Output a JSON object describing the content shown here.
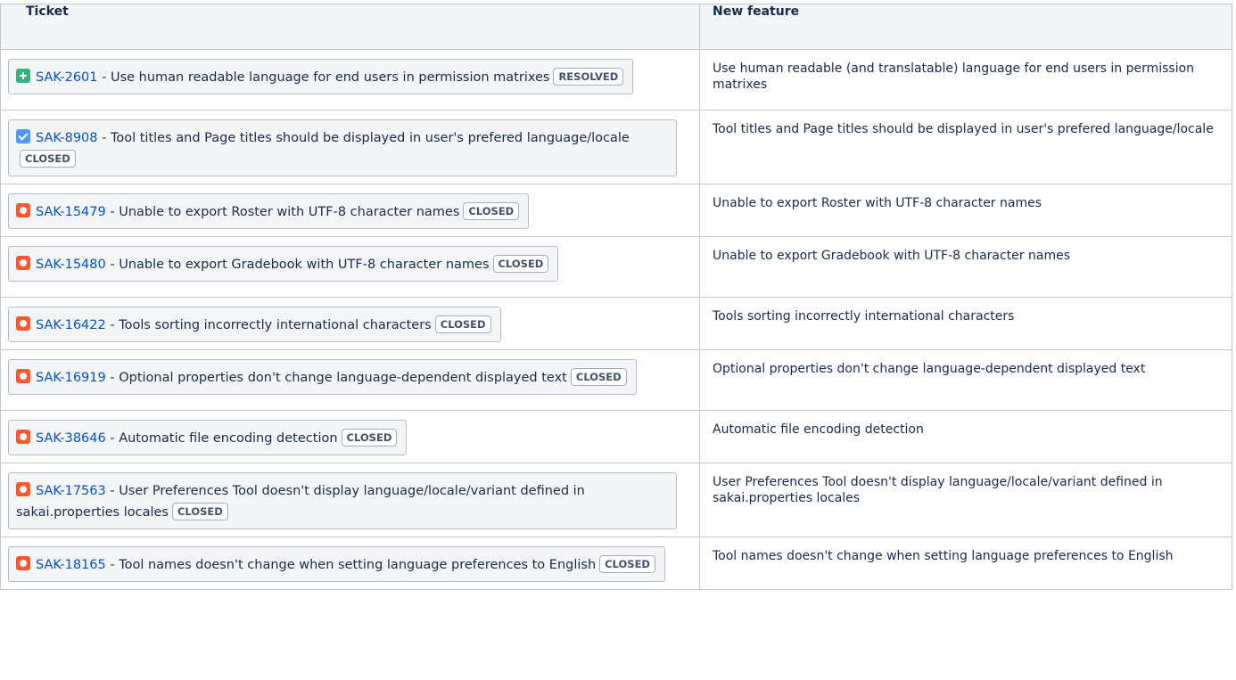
{
  "headers": {
    "ticket": "Ticket",
    "feature": "New feature"
  },
  "colors": {
    "link": "#0052cc",
    "new_feature_icon": "#36b37e",
    "task_icon": "#4c9aff",
    "bug_icon": "#ff5630"
  },
  "rows": [
    {
      "icon": "plus-icon",
      "key": "SAK-2601",
      "summary": "Use human readable language for end users in permission matrixes",
      "status": "RESOLVED",
      "feature": "Use human readable (and translatable) language for end users in permission matrixes"
    },
    {
      "icon": "check-icon",
      "key": "SAK-8908",
      "summary": "Tool titles and Page titles should be displayed in user's prefered language/locale",
      "status": "CLOSED",
      "feature": "Tool titles and Page titles should be displayed in user's prefered language/locale"
    },
    {
      "icon": "bug-icon",
      "key": "SAK-15479",
      "summary": "Unable to export Roster with UTF-8 character names",
      "status": "CLOSED",
      "feature": "Unable to export Roster with UTF-8 character names"
    },
    {
      "icon": "bug-icon",
      "key": "SAK-15480",
      "summary": "Unable to export Gradebook with UTF-8 character names",
      "status": "CLOSED",
      "feature": "Unable to export Gradebook with UTF-8 character names"
    },
    {
      "icon": "bug-icon",
      "key": "SAK-16422",
      "summary": "Tools sorting incorrectly international characters",
      "status": "CLOSED",
      "feature": "Tools sorting incorrectly international characters"
    },
    {
      "icon": "bug-icon",
      "key": "SAK-16919",
      "summary": "Optional properties don't change language-dependent displayed text",
      "status": "CLOSED",
      "feature": "Optional properties don't change language-dependent displayed text"
    },
    {
      "icon": "bug-icon",
      "key": "SAK-38646",
      "summary": "Automatic file encoding detection",
      "status": "CLOSED",
      "feature": "Automatic file encoding detection"
    },
    {
      "icon": "bug-icon",
      "key": "SAK-17563",
      "summary": "User Preferences Tool doesn't display language/locale/variant defined in sakai.properties locales",
      "status": "CLOSED",
      "feature": "User Preferences Tool doesn't display language/locale/variant defined in sakai.properties locales"
    },
    {
      "icon": "bug-icon",
      "key": "SAK-18165",
      "summary": "Tool names doesn't change when setting language preferences to English",
      "status": "CLOSED",
      "feature": "Tool names doesn't change when setting language preferences to English"
    }
  ]
}
